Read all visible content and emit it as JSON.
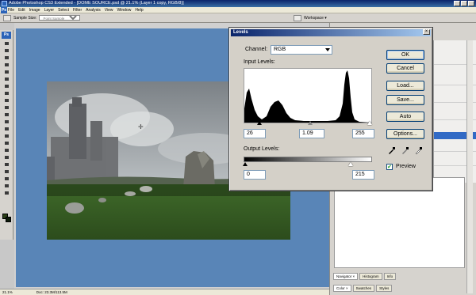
{
  "window": {
    "title": "Adobe Photoshop CS3 Extended - [DOME SOURCE.psd @ 21.1% (Layer 1 copy, RGB/8)]"
  },
  "menubar": {
    "logo": "Ps",
    "items": [
      "File",
      "Edit",
      "Image",
      "Layer",
      "Select",
      "Filter",
      "Analysis",
      "View",
      "Window",
      "Help"
    ]
  },
  "options_bar": {
    "sample_size_label": "Sample Size:",
    "sample_size_value": "Point Sample",
    "workspace_label": "Workspace ▾"
  },
  "toolbox": {
    "logo": "Ps",
    "foreground_color": "#2a3f17",
    "background_color": "#0d1a0a"
  },
  "status_bar": {
    "zoom": "21.1%",
    "doc_size": "Doc: 23.3M/113.5M"
  },
  "panels": {
    "bottom_tabs_1": [
      "Navigator ×",
      "Histogram",
      "Info"
    ],
    "bottom_tabs_2": [
      "Color ×",
      "Swatches",
      "Styles"
    ]
  },
  "levels_dialog": {
    "title": "Levels",
    "channel_label": "Channel:",
    "channel_value": "RGB",
    "input_levels_label": "Input Levels:",
    "input_black": "26",
    "input_gamma": "1.09",
    "input_white": "255",
    "output_levels_label": "Output Levels:",
    "output_black": "0",
    "output_white": "215",
    "buttons": {
      "ok": "OK",
      "cancel": "Cancel",
      "load": "Load...",
      "save": "Save...",
      "auto": "Auto",
      "options": "Options..."
    },
    "preview_label": "Preview",
    "preview_checked": true
  },
  "colors": {
    "canvas_blue": "#5985b7",
    "selection_blue": "#316ac5",
    "title_blue": "#0a246a"
  }
}
